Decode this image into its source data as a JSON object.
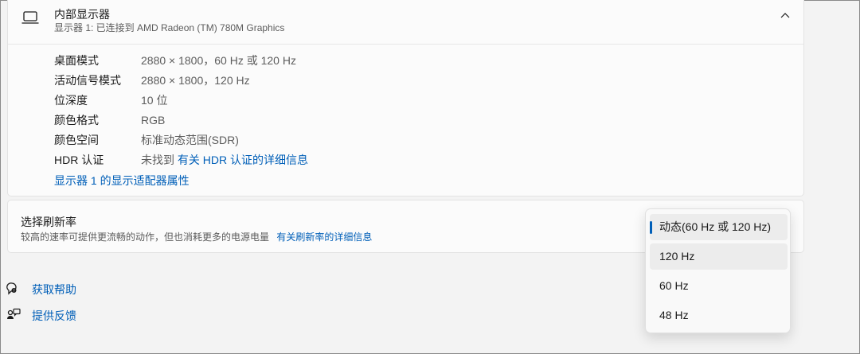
{
  "display": {
    "title": "内部显示器",
    "subtitle": "显示器 1: 已连接到 AMD Radeon (TM) 780M Graphics",
    "properties": [
      {
        "label": "桌面模式",
        "value": "2880 × 1800，60 Hz 或 120 Hz"
      },
      {
        "label": "活动信号模式",
        "value": "2880 × 1800，120 Hz"
      },
      {
        "label": "位深度",
        "value": "10 位"
      },
      {
        "label": "颜色格式",
        "value": "RGB"
      },
      {
        "label": "颜色空间",
        "value": "标准动态范围(SDR)"
      }
    ],
    "hdr": {
      "label": "HDR 认证",
      "value": "未找到",
      "link": "有关 HDR 认证的详细信息"
    },
    "adapter_link": "显示器 1 的显示适配器属性"
  },
  "refresh": {
    "title": "选择刷新率",
    "description": "较高的速率可提供更流畅的动作，但也消耗更多的电源电量",
    "link": "有关刷新率的详细信息"
  },
  "dropdown": {
    "options": [
      "动态(60 Hz 或 120 Hz)",
      "120 Hz",
      "60 Hz",
      "48 Hz"
    ],
    "selected_index": 0
  },
  "footer": {
    "help": "获取帮助",
    "feedback": "提供反馈"
  },
  "colors": {
    "accent": "#005fb8",
    "background": "#f3f3f3",
    "card": "#fbfbfb"
  },
  "icons": [
    "laptop-icon",
    "chevron-up-icon",
    "help-icon",
    "feedback-icon"
  ]
}
